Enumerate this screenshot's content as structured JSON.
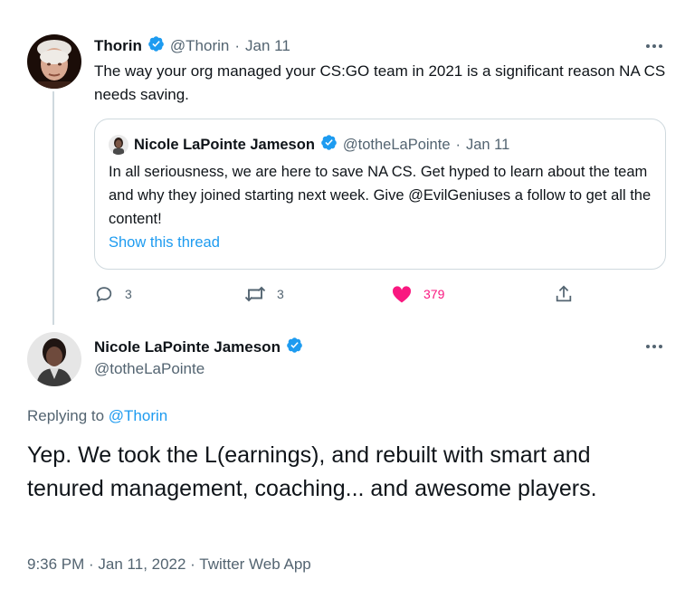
{
  "tweet1": {
    "name": "Thorin",
    "handle": "@Thorin",
    "date": "Jan 11",
    "text": "The way your org managed your CS:GO team in 2021 is a significant reason NA CS needs saving.",
    "quote": {
      "name": "Nicole LaPointe Jameson",
      "handle": "@totheLaPointe",
      "date": "Jan 11",
      "text": "In all seriousness, we are here to save NA CS. Get hyped to learn about the team and why they joined starting next week. Give @EvilGeniuses a follow to get all the content!",
      "show_thread": "Show this thread"
    },
    "actions": {
      "replies": "3",
      "retweets": "3",
      "likes": "379"
    }
  },
  "tweet2": {
    "name": "Nicole LaPointe Jameson",
    "handle": "@totheLaPointe",
    "replying_prefix": "Replying to ",
    "replying_to": "@Thorin",
    "text": "Yep. We took the L(earnings), and rebuilt with smart and tenured management, coaching... and awesome players.",
    "meta": "9:36 PM · Jan 11, 2022 · Twitter Web App"
  },
  "colors": {
    "accent": "#1d9bf0",
    "like": "#f91880",
    "muted": "#536471",
    "border": "#cfd9de"
  },
  "icons": {
    "verified": "verified-badge-icon",
    "more": "more-dots-icon",
    "reply": "reply-icon",
    "retweet": "retweet-icon",
    "like": "heart-filled-icon",
    "share": "share-icon"
  }
}
